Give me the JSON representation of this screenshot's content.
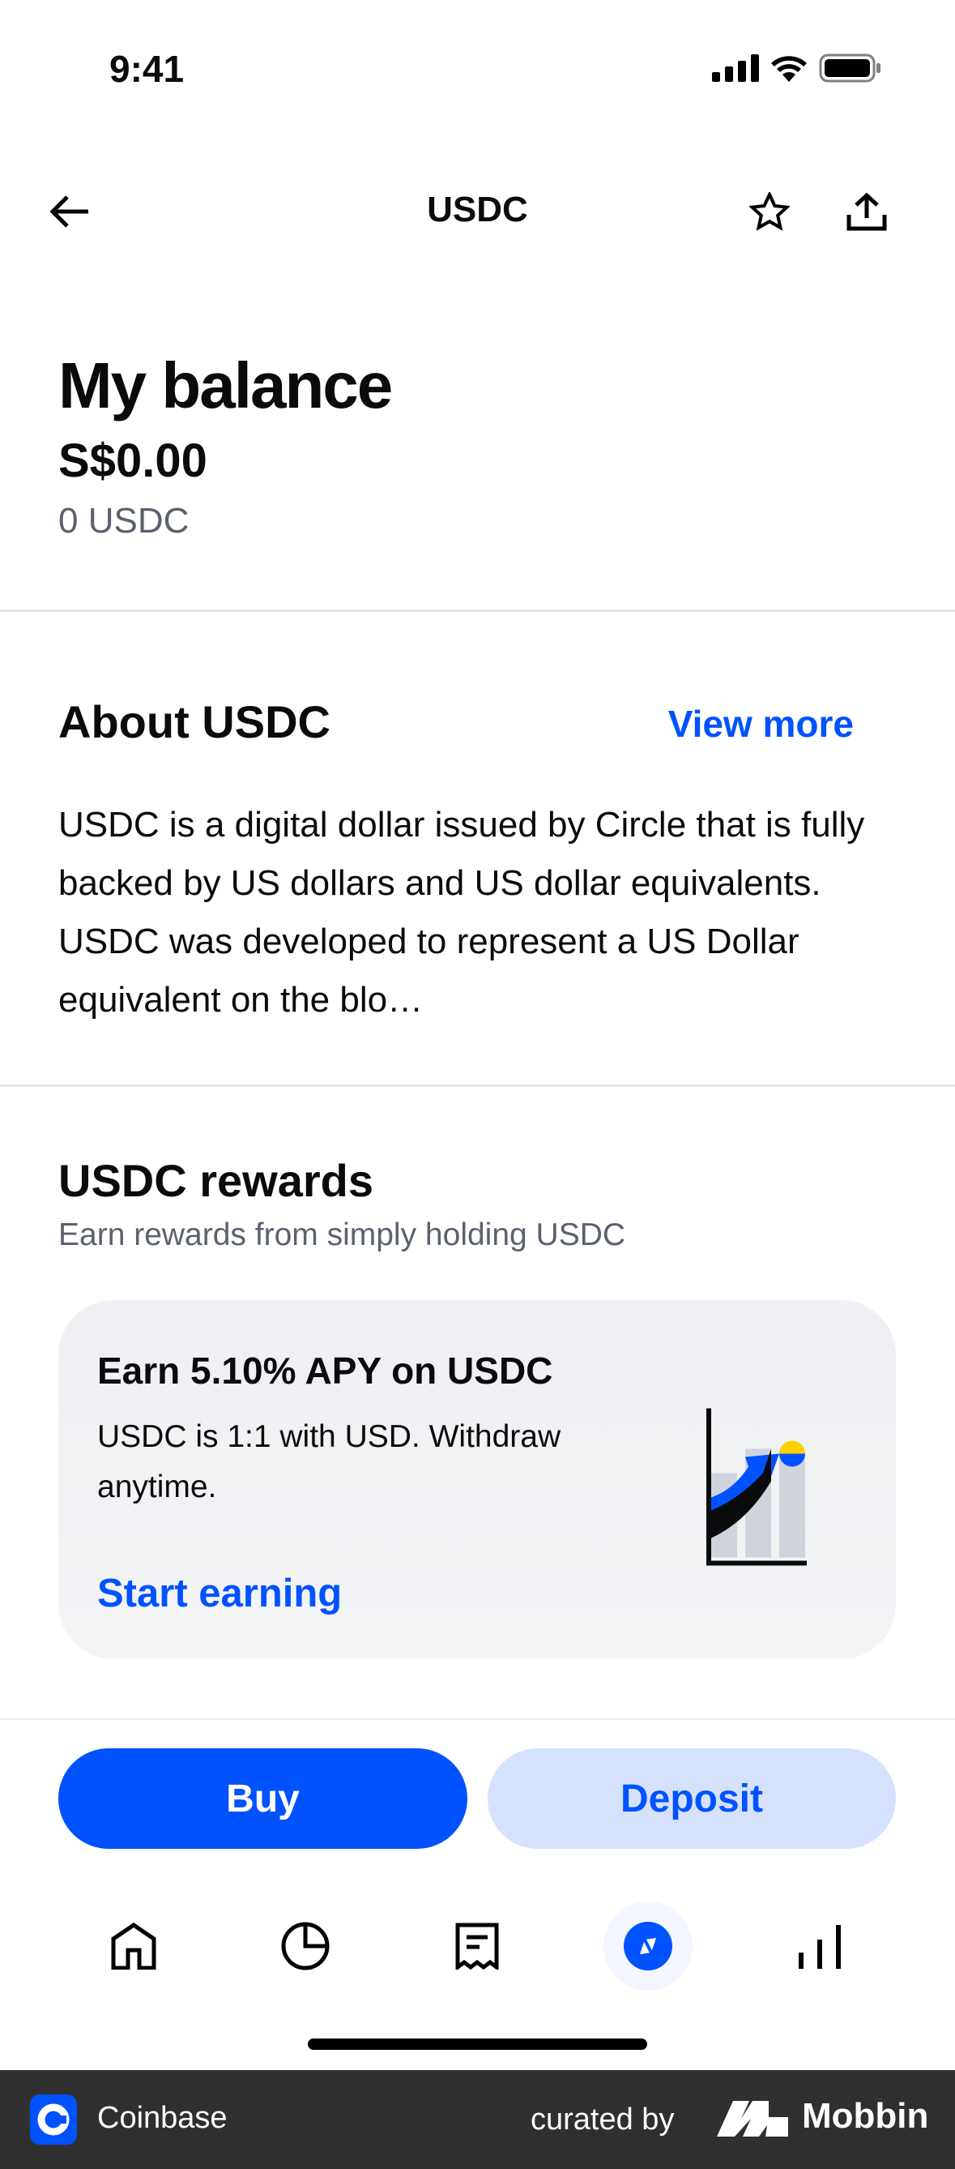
{
  "status_bar": {
    "time": "9:41"
  },
  "header": {
    "title": "USDC"
  },
  "balance": {
    "heading": "My balance",
    "fiat": "S$0.00",
    "crypto": "0 USDC"
  },
  "about": {
    "title": "About USDC",
    "view_more": "View more",
    "text": "USDC is a digital dollar issued by Circle that is fully backed by US dollars and US dollar equivalents. USDC was developed to represent a US Dollar equivalent on the blo…"
  },
  "rewards": {
    "title": "USDC rewards",
    "subtitle": "Earn rewards from simply holding USDC",
    "card_title": "Earn 5.10% APY on USDC",
    "card_text": "USDC is 1:1 with USD. Withdraw anytime.",
    "card_link": "Start earning"
  },
  "actions": {
    "buy": "Buy",
    "deposit": "Deposit"
  },
  "tabs": [
    "home-icon",
    "portfolio-icon",
    "transactions-icon",
    "explore-icon",
    "trade-icon"
  ],
  "footer": {
    "app": "Coinbase",
    "curated": "curated by",
    "brand": "Mobbin"
  },
  "colors": {
    "accent": "#0052ff",
    "deposit_bg": "#d6e2fd"
  }
}
